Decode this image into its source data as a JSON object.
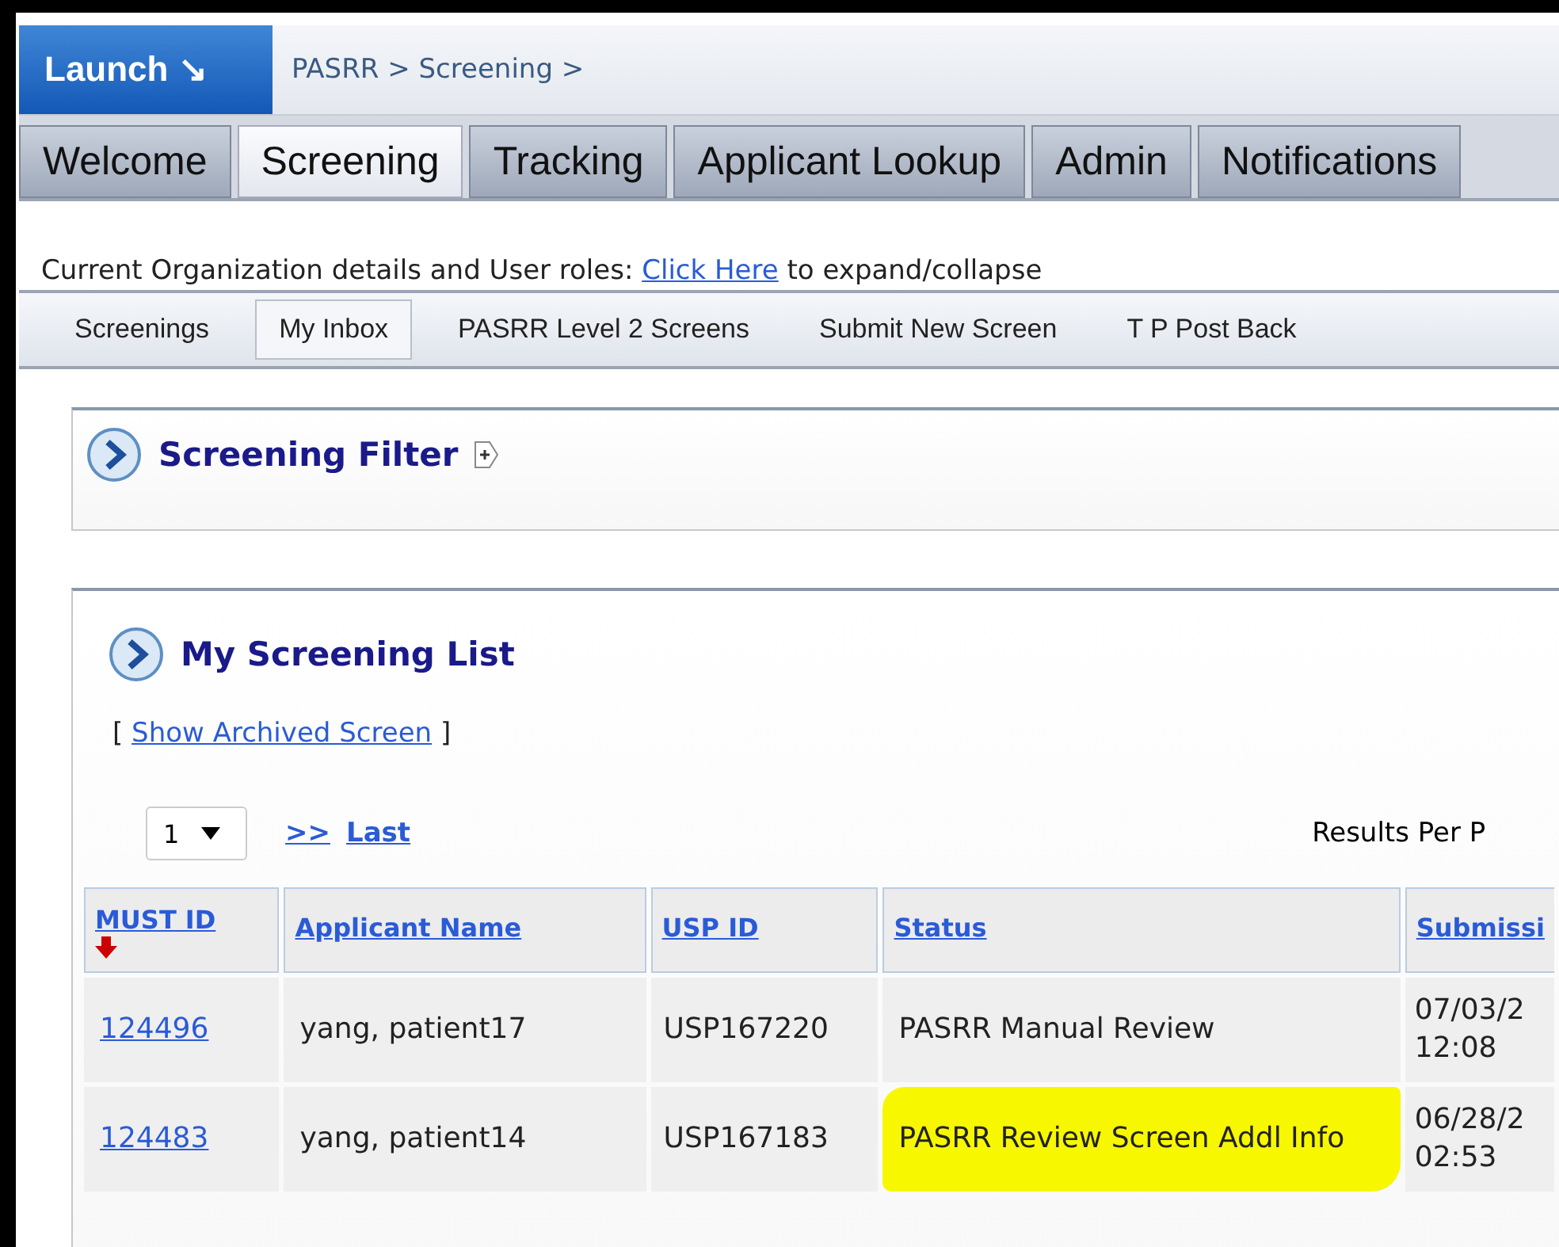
{
  "header": {
    "launch": "Launch ↘",
    "breadcrumb": "PASRR > Screening >"
  },
  "main_tabs": [
    {
      "label": "Welcome",
      "selected": false
    },
    {
      "label": "Screening",
      "selected": true
    },
    {
      "label": "Tracking",
      "selected": false
    },
    {
      "label": "Applicant Lookup",
      "selected": false
    },
    {
      "label": "Admin",
      "selected": false
    },
    {
      "label": "Notifications",
      "selected": false
    }
  ],
  "org_line": {
    "before": "Current Organization details and User roles:",
    "link": "Click Here",
    "after": "to expand/collapse"
  },
  "sub_tabs": [
    {
      "label": "Screenings",
      "selected": false
    },
    {
      "label": "My Inbox",
      "selected": true
    },
    {
      "label": "PASRR Level 2 Screens",
      "selected": false
    },
    {
      "label": "Submit New Screen",
      "selected": false
    },
    {
      "label": "T P Post Back",
      "selected": false
    }
  ],
  "filter_panel": {
    "title": "Screening Filter"
  },
  "list_panel": {
    "title": "My Screening List",
    "archived_open": "[",
    "archived_link": "Show Archived Screen",
    "archived_close": "]",
    "page_select": "1",
    "next": ">>",
    "last": "Last",
    "results_per_page": "Results Per P"
  },
  "table": {
    "columns": [
      {
        "label": "MUST ID",
        "sorted": true
      },
      {
        "label": "Applicant Name",
        "sorted": false
      },
      {
        "label": "USP ID",
        "sorted": false
      },
      {
        "label": "Status",
        "sorted": false
      },
      {
        "label": "Submissi",
        "sorted": false
      }
    ],
    "rows": [
      {
        "must_id": "124496",
        "name": "yang, patient17",
        "usp_id": "USP167220",
        "status": "PASRR Manual Review",
        "status_highlighted": false,
        "submitted": [
          "07/03/2",
          "12:08"
        ]
      },
      {
        "must_id": "124483",
        "name": "yang, patient14",
        "usp_id": "USP167183",
        "status": "PASRR Review Screen Addl Info",
        "status_highlighted": true,
        "submitted": [
          "06/28/2",
          "02:53"
        ]
      }
    ]
  }
}
